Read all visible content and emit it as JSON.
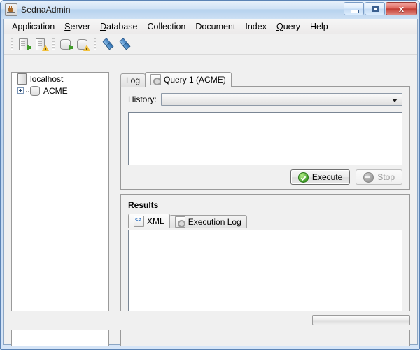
{
  "window": {
    "title": "SednaAdmin",
    "icon": "java-cup-icon",
    "controls": {
      "minimize": "minimize-button",
      "maximize": "maximize-button",
      "close_label": "x"
    }
  },
  "menubar": {
    "items": [
      {
        "label": "Application",
        "mnemonic": ""
      },
      {
        "label": "Server",
        "mnemonic": "S"
      },
      {
        "label": "Database",
        "mnemonic": "D"
      },
      {
        "label": "Collection",
        "mnemonic": ""
      },
      {
        "label": "Document",
        "mnemonic": ""
      },
      {
        "label": "Index",
        "mnemonic": ""
      },
      {
        "label": "Query",
        "mnemonic": "Q"
      },
      {
        "label": "Help",
        "mnemonic": ""
      }
    ]
  },
  "toolbar": {
    "buttons": [
      {
        "name": "connect-server-icon"
      },
      {
        "name": "disconnect-server-icon"
      },
      {
        "name": "connect-database-icon"
      },
      {
        "name": "disconnect-database-icon"
      },
      {
        "name": "plug-connect-icon"
      },
      {
        "name": "plug-disconnect-icon"
      }
    ]
  },
  "tree": {
    "nodes": [
      {
        "label": "localhost",
        "icon": "server-icon",
        "expandable": false
      },
      {
        "label": "ACME",
        "icon": "database-icon",
        "expandable": true,
        "toggle": "plus"
      }
    ]
  },
  "main_tabs": [
    {
      "label": "Log",
      "active": false
    },
    {
      "label": "Query 1 (ACME)",
      "active": true,
      "icon": "query-icon"
    }
  ],
  "query_panel": {
    "history_label": "History:",
    "history_value": "",
    "history_placeholder": "",
    "editor_value": "",
    "execute": {
      "label_pre": "E",
      "label_mnemonic": "x",
      "label_post": "ecute",
      "full": "Execute",
      "enabled": true
    },
    "stop": {
      "label_mnemonic": "S",
      "label_post": "top",
      "full": "Stop",
      "enabled": false
    }
  },
  "results": {
    "title": "Results",
    "tabs": [
      {
        "label": "XML",
        "active": true,
        "icon": "xml-document-icon"
      },
      {
        "label": "Execution Log",
        "active": false,
        "icon": "gear-document-icon"
      }
    ],
    "content": ""
  },
  "statusbar": {
    "progress_value": "",
    "message": ""
  },
  "colors": {
    "titlebar_blue": "#bed5ef",
    "close_red": "#c33d33",
    "accent_green": "#3f9c28",
    "warn_yellow": "#f2c13c",
    "panel_gray": "#f0f0f0"
  }
}
